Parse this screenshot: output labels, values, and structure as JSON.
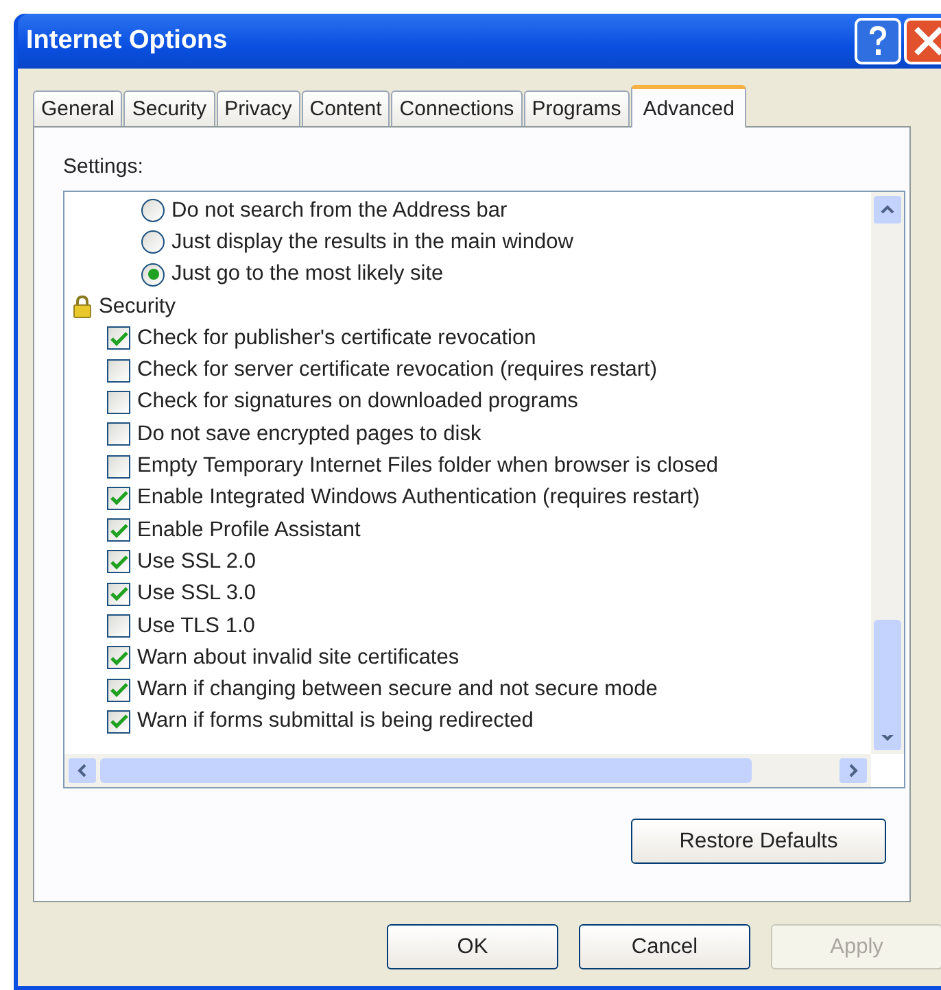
{
  "window": {
    "title": "Internet Options"
  },
  "tabs": [
    {
      "label": "General",
      "selected": false
    },
    {
      "label": "Security",
      "selected": false
    },
    {
      "label": "Privacy",
      "selected": false
    },
    {
      "label": "Content",
      "selected": false
    },
    {
      "label": "Connections",
      "selected": false
    },
    {
      "label": "Programs",
      "selected": false
    },
    {
      "label": "Advanced",
      "selected": true
    }
  ],
  "settings_label": "Settings:",
  "settings": [
    {
      "kind": "radio",
      "label": "Do not search from the Address bar",
      "selected": false
    },
    {
      "kind": "radio",
      "label": "Just display the results in the main window",
      "selected": false
    },
    {
      "kind": "radio",
      "label": "Just go to the most likely site",
      "selected": true
    },
    {
      "kind": "group",
      "label": "Security",
      "children": [
        {
          "kind": "checkbox",
          "label": "Check for publisher's certificate revocation",
          "checked": true
        },
        {
          "kind": "checkbox",
          "label": "Check for server certificate revocation (requires restart)",
          "checked": false
        },
        {
          "kind": "checkbox",
          "label": "Check for signatures on downloaded programs",
          "checked": false
        },
        {
          "kind": "checkbox",
          "label": "Do not save encrypted pages to disk",
          "checked": false
        },
        {
          "kind": "checkbox",
          "label": "Empty Temporary Internet Files folder when browser is closed",
          "checked": false
        },
        {
          "kind": "checkbox",
          "label": "Enable Integrated Windows Authentication (requires restart)",
          "checked": true
        },
        {
          "kind": "checkbox",
          "label": "Enable Profile Assistant",
          "checked": true
        },
        {
          "kind": "checkbox",
          "label": "Use SSL 2.0",
          "checked": true
        },
        {
          "kind": "checkbox",
          "label": "Use SSL 3.0",
          "checked": true
        },
        {
          "kind": "checkbox",
          "label": "Use TLS 1.0",
          "checked": false
        },
        {
          "kind": "checkbox",
          "label": "Warn about invalid site certificates",
          "checked": true
        },
        {
          "kind": "checkbox",
          "label": "Warn if changing between secure and not secure mode",
          "checked": true
        },
        {
          "kind": "checkbox",
          "label": "Warn if forms submittal is being redirected",
          "checked": true
        }
      ]
    }
  ],
  "restore_button": {
    "label": "Restore Defaults",
    "disabled": false
  },
  "buttons": [
    {
      "label": "OK",
      "disabled": false
    },
    {
      "label": "Cancel",
      "disabled": false
    },
    {
      "label": "Apply",
      "disabled": true
    }
  ]
}
